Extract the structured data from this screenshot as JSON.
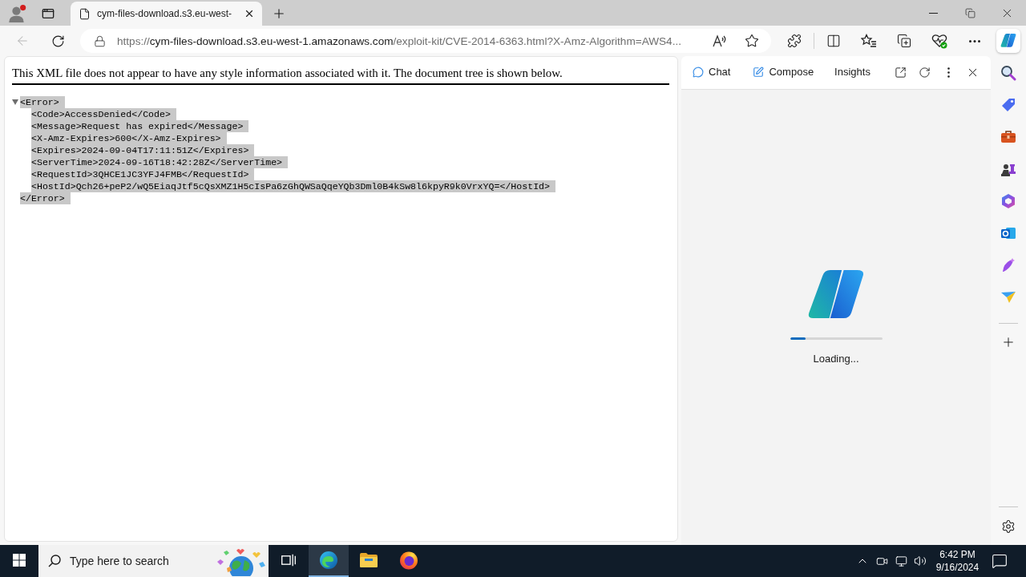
{
  "browser": {
    "tabs": [
      {
        "title": "cym-files-download.s3.eu-west-",
        "selected": true
      }
    ],
    "navigation": {
      "back_disabled": true
    },
    "address_bar": {
      "scheme": "https://",
      "host": "cym-files-download.s3.eu-west-1.amazonaws.com",
      "path": "/exploit-kit/CVE-2014-6363.html?X-Amz-Algorithm=AWS4..."
    }
  },
  "page": {
    "notice": "This XML file does not appear to have any style information associated with it. The document tree is shown below.",
    "tree": {
      "expanded": true,
      "highlighted": true,
      "open_tag": "<Error>",
      "children": [
        "<Code>AccessDenied</Code>",
        "<Message>Request has expired</Message>",
        "<X-Amz-Expires>600</X-Amz-Expires>",
        "<Expires>2024-09-04T17:11:51Z</Expires>",
        "<ServerTime>2024-09-16T18:42:28Z</ServerTime>",
        "<RequestId>3QHCE1JC3YFJ4FMB</RequestId>",
        "<HostId>Qch26+peP2/wQ5EiaqJtf5cQsXMZ1H5cIsPa6zGhQWSaQqeYQb3Dml0B4kSw8l6kpyR9k0VrxYQ=</HostId>"
      ],
      "close_tag": "</Error>"
    }
  },
  "copilot": {
    "tabs": [
      {
        "label": "Chat",
        "selected": false
      },
      {
        "label": "Compose",
        "selected": false
      },
      {
        "label": "Insights",
        "selected": false
      }
    ],
    "loading": {
      "level": 0.17,
      "label": "Loading..."
    }
  },
  "taskbar": {
    "search": {
      "placeholder": "Type here to search"
    },
    "apps": [
      {
        "selected": true
      },
      {
        "selected": false
      },
      {
        "selected": false
      }
    ],
    "clock": {
      "time": "6:42 PM",
      "date": "9/16/2024"
    }
  }
}
